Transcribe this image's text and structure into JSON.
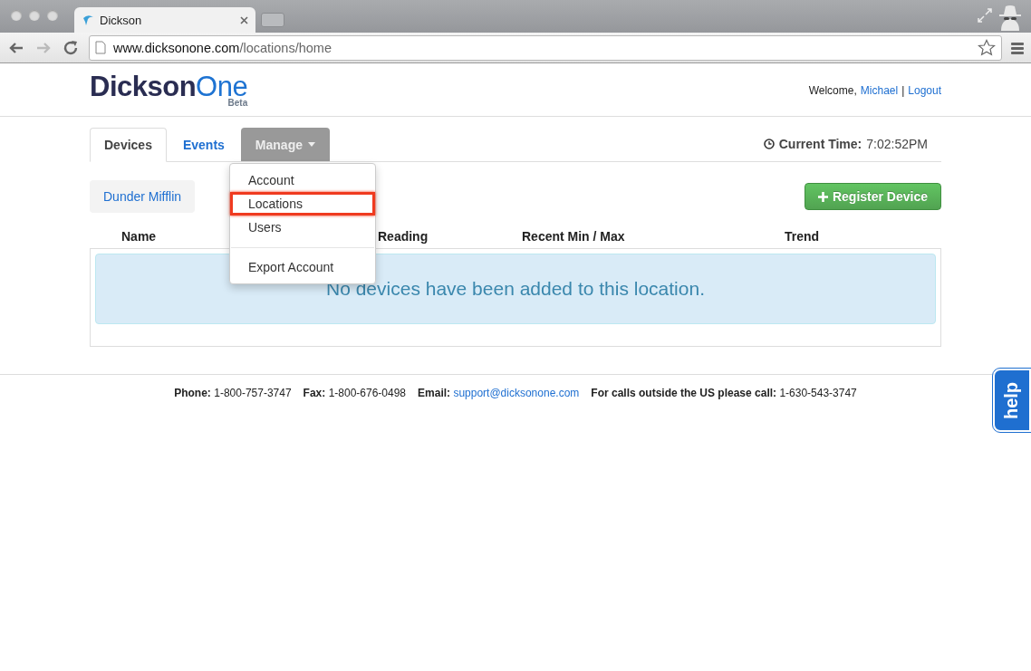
{
  "browser": {
    "tab_title": "Dickson",
    "url_host": "www.dicksonone.com",
    "url_path": "/locations/home"
  },
  "header": {
    "logo_main": "Dickson",
    "logo_accent": "One",
    "logo_sub": "Beta",
    "welcome": "Welcome,",
    "user": "Michael",
    "separator": "|",
    "logout": "Logout"
  },
  "tabs": [
    {
      "label": "Devices",
      "selected": true,
      "kind": "tab",
      "expanded": false
    },
    {
      "label": "Events",
      "selected": false,
      "kind": "tab",
      "expanded": false
    },
    {
      "label": "Manage",
      "selected": false,
      "kind": "dropdown",
      "expanded": true
    }
  ],
  "menu": [
    {
      "kind": "item",
      "label": "Account",
      "highlighted": false
    },
    {
      "kind": "item",
      "label": "Locations",
      "highlighted": true
    },
    {
      "kind": "item",
      "label": "Users",
      "highlighted": false
    },
    {
      "kind": "divider"
    },
    {
      "kind": "item",
      "label": "Export Account",
      "highlighted": false
    }
  ],
  "current_time": {
    "label": "Current Time:",
    "value": "7:02:52PM"
  },
  "location_button": "Dunder Mifflin",
  "register_button": "Register Device",
  "table": {
    "columns": [
      "Name",
      "Reading",
      "Recent Min / Max",
      "Trend"
    ],
    "empty_message": "No devices have been added to this location."
  },
  "footer": [
    {
      "kind": "text",
      "label": "Phone:",
      "value": "1-800-757-3747"
    },
    {
      "kind": "text",
      "label": "Fax:",
      "value": "1-800-676-0498"
    },
    {
      "kind": "link",
      "label": "Email:",
      "value": "support@dicksonone.com"
    },
    {
      "kind": "text",
      "label": "For calls outside the US please call:",
      "value": "1-630-543-3747"
    }
  ],
  "help_tab": "help"
}
